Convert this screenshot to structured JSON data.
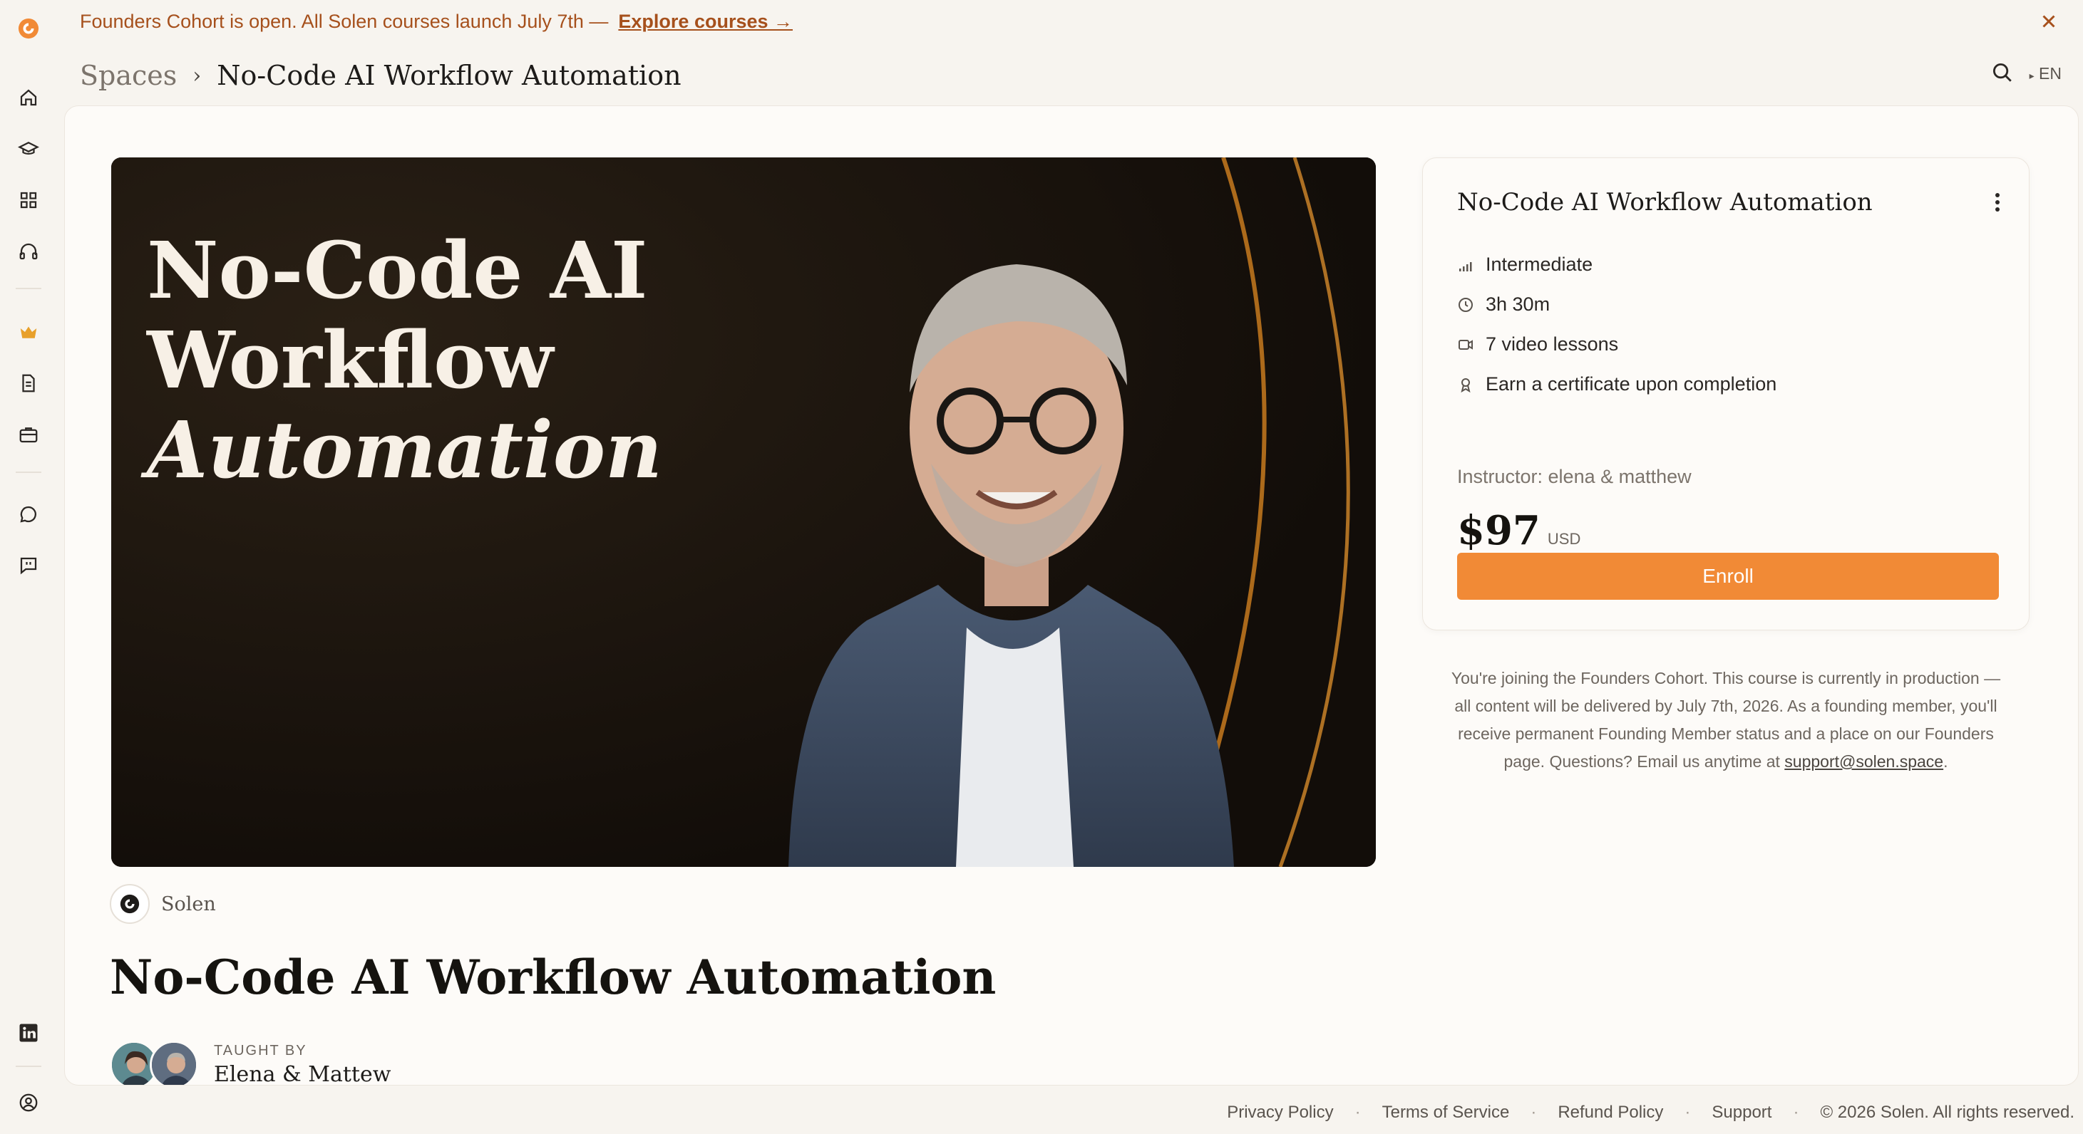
{
  "banner": {
    "text": "Founders Cohort is open. All Solen courses launch July 7th —",
    "link": "Explore courses →"
  },
  "breadcrumb": {
    "root": "Spaces",
    "current": "No-Code AI Workflow Automation"
  },
  "top_right": {
    "lang": "EN"
  },
  "sidebar_icons": [
    "home-icon",
    "graduation-cap-icon",
    "grid-icon",
    "headphones-icon",
    "crown-icon",
    "document-icon",
    "briefcase-icon",
    "chat-bubble-icon",
    "feedback-icon",
    "linkedin-icon",
    "user-circle-icon"
  ],
  "hero": {
    "line1": "No-Code AI",
    "line2": "Workflow",
    "line3": "Automation"
  },
  "brand": {
    "name": "Solen"
  },
  "course": {
    "title": "No-Code AI Workflow Automation",
    "taught_by_label": "TAUGHT BY",
    "instructors_display": "Elena & Mattew"
  },
  "card": {
    "title": "No-Code AI Workflow Automation",
    "level": "Intermediate",
    "duration": "3h 30m",
    "lessons": "7 video lessons",
    "certificate": "Earn a certificate upon completion",
    "instructor": "Instructor: elena & matthew",
    "price": "$97",
    "currency": "USD",
    "enroll": "Enroll"
  },
  "note": {
    "text": "You're joining the Founders Cohort. This course is currently in production — all content will be delivered by July 7th, 2026. As a founding member, you'll receive permanent Founding Member status and a place on our Founders page. Questions? Email us anytime at",
    "email": "support@solen.space",
    "end": "."
  },
  "footer": {
    "privacy": "Privacy Policy",
    "terms": "Terms of Service",
    "refund": "Refund Policy",
    "support": "Support",
    "copyright": "© 2026 Solen. All rights reserved."
  },
  "colors": {
    "accent": "#f18a36",
    "banner_text": "#a6501c",
    "background": "#f7f4ef"
  }
}
